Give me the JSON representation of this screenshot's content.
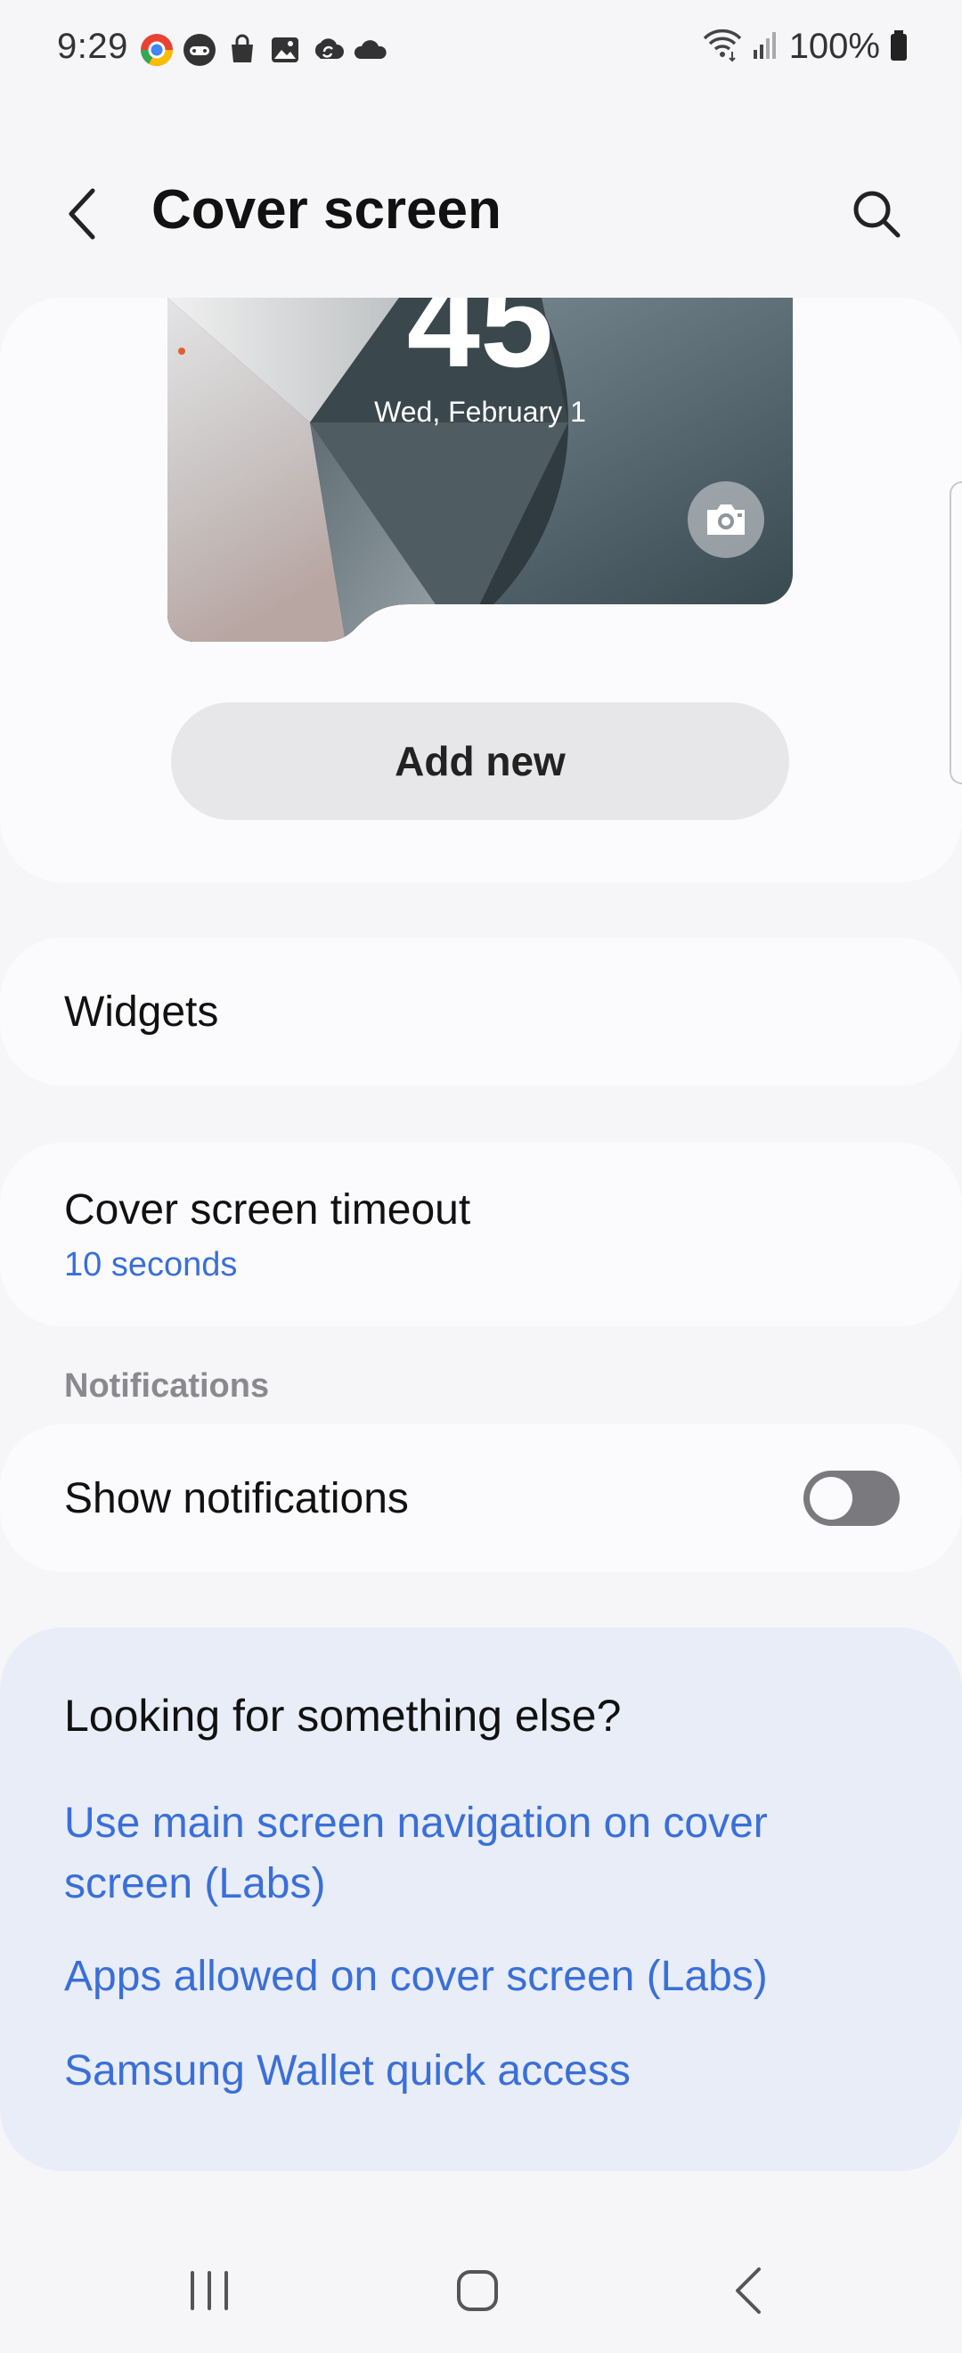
{
  "status_bar": {
    "time": "9:29",
    "battery": "100%",
    "notification_icons": [
      "chrome-icon",
      "game-icon",
      "shopping-bag-icon",
      "gallery-icon",
      "sync-icon",
      "cloud-icon"
    ]
  },
  "header": {
    "title": "Cover screen"
  },
  "preview": {
    "clock": "45",
    "date": "Wed, February 1",
    "add_new_label": "Add new"
  },
  "settings": {
    "widgets_label": "Widgets",
    "timeout_label": "Cover screen timeout",
    "timeout_value": "10 seconds",
    "notifications_section": "Notifications",
    "show_notifications_label": "Show notifications",
    "show_notifications_enabled": false
  },
  "suggestions": {
    "title": "Looking for something else?",
    "links": [
      "Use main screen navigation on cover screen (Labs)",
      "Apps allowed on cover screen (Labs)",
      "Samsung Wallet quick access"
    ]
  },
  "colors": {
    "accent": "#3a6fd8",
    "background": "#f6f6f8",
    "card": "#fbfbfd",
    "suggest_card": "#e8edf8"
  }
}
